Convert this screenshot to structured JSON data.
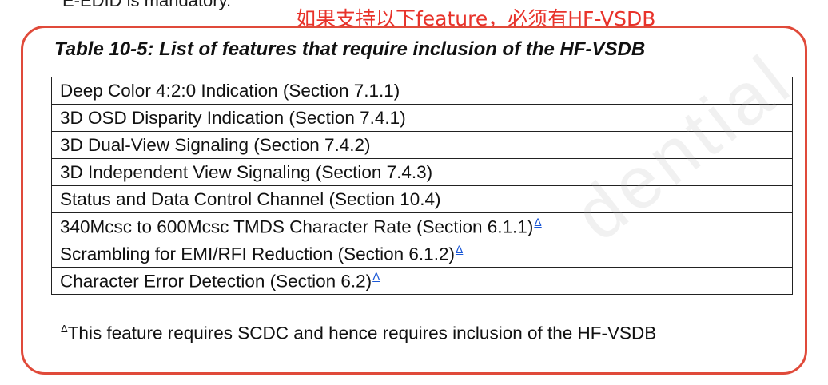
{
  "header": {
    "cut_text": "E-EDID is mandatory.",
    "annotation": "如果支持以下feature，必须有HF-VSDB"
  },
  "table": {
    "title": "Table 10-5: List of features that require inclusion of the HF-VSDB",
    "rows": [
      {
        "text": "Deep Color 4:2:0 Indication (Section 7.1.1)",
        "delta": ""
      },
      {
        "text": "3D OSD Disparity Indication (Section 7.4.1)",
        "delta": ""
      },
      {
        "text": "3D Dual-View Signaling (Section 7.4.2)",
        "delta": ""
      },
      {
        "text": "3D Independent View Signaling (Section 7.4.3)",
        "delta": ""
      },
      {
        "text": "Status and Data Control Channel (Section 10.4)",
        "delta": ""
      },
      {
        "text": "340Mcsc to 600Mcsc TMDS Character Rate (Section 6.1.1)",
        "delta": "Δ"
      },
      {
        "text": "Scrambling for EMI/RFI Reduction (Section 6.1.2)",
        "delta": "Δ"
      },
      {
        "text": "Character Error Detection (Section 6.2)",
        "delta": "Δ"
      }
    ],
    "footnote_mark": "Δ",
    "footnote": "This feature requires SCDC and hence requires inclusion of the HF-VSDB"
  },
  "watermark": "dential",
  "colors": {
    "annotation": "#e8322a",
    "frame": "#e04a3a",
    "link": "#1a57d6"
  }
}
